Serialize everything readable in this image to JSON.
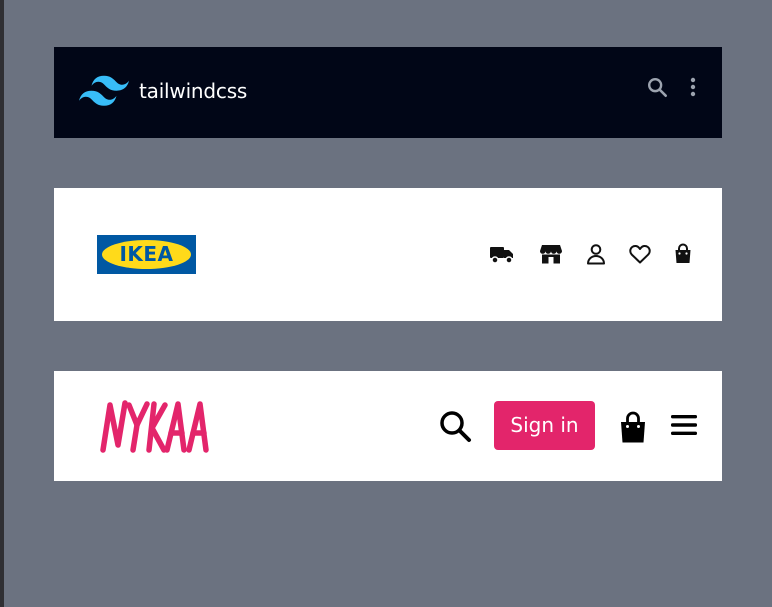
{
  "tailwind_bar": {
    "wordmark": "tailwindcss",
    "background": "#010617",
    "logo_color": "#38bdf8",
    "icons": [
      "search-icon",
      "vertical-dots-icon"
    ]
  },
  "ikea_bar": {
    "logo_text": "IKEA",
    "logo_blue": "#0058a3",
    "logo_yellow": "#ffda1a",
    "icons": [
      "truck-icon",
      "store-icon",
      "user-icon",
      "heart-icon",
      "shopping-bag-icon"
    ]
  },
  "nykaa_bar": {
    "logo_text": "NYKAA",
    "brand_color": "#e3256b",
    "sign_in_label": "Sign in",
    "icons": [
      "search-icon",
      "shopping-bag-icon",
      "hamburger-menu-icon"
    ]
  },
  "page_background": "#6b7280"
}
